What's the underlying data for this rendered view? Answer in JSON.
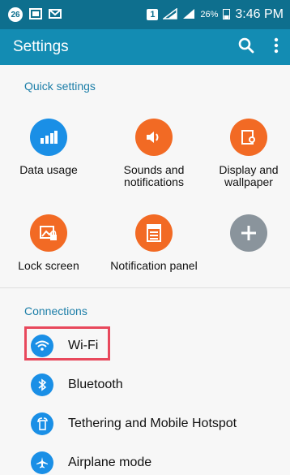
{
  "status_bar": {
    "notification_count": "26",
    "sim_label": "1",
    "battery": "26%",
    "time": "3:46 PM"
  },
  "app_bar": {
    "title": "Settings",
    "search_icon": "search-icon",
    "more_icon": "more-vert-icon"
  },
  "quick_settings": {
    "header": "Quick settings",
    "items": [
      {
        "label": "Data usage",
        "icon": "bar-chart-icon",
        "color": "#1a8fe6"
      },
      {
        "label": "Sounds and notifications",
        "icon": "speaker-icon",
        "color": "#f26a24"
      },
      {
        "label": "Display and wallpaper",
        "icon": "display-icon",
        "color": "#f26a24"
      },
      {
        "label": "Lock screen",
        "icon": "lock-screen-icon",
        "color": "#f26a24"
      },
      {
        "label": "Notification panel",
        "icon": "notification-panel-icon",
        "color": "#f26a24"
      },
      {
        "label": "",
        "icon": "plus-icon",
        "color": "#8a949c"
      }
    ]
  },
  "connections": {
    "header": "Connections",
    "items": [
      {
        "label": "Wi-Fi",
        "icon": "wifi-icon"
      },
      {
        "label": "Bluetooth",
        "icon": "bluetooth-icon"
      },
      {
        "label": "Tethering and Mobile Hotspot",
        "icon": "tethering-icon"
      },
      {
        "label": "Airplane mode",
        "icon": "airplane-icon"
      }
    ]
  },
  "colors": {
    "status_bar": "#0e6f8e",
    "app_bar": "#138cb3",
    "accent": "#1c7ea8",
    "highlight": "#e8485c"
  }
}
